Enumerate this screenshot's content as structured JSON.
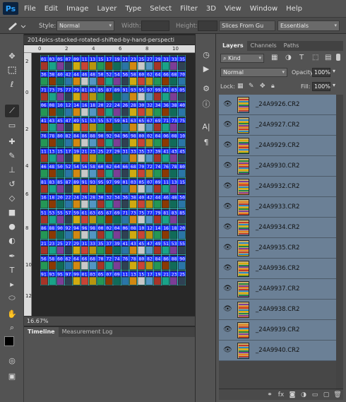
{
  "app": {
    "logo": "Ps"
  },
  "menu": [
    "File",
    "Edit",
    "Image",
    "Layer",
    "Type",
    "Select",
    "Filter",
    "3D",
    "View",
    "Window",
    "Help"
  ],
  "options": {
    "style_label": "Style:",
    "style_value": "Normal",
    "width_label": "Width:",
    "height_label": "Height:",
    "slices_button": "Slices From Gu",
    "workspace": "Essentials"
  },
  "document": {
    "tab_title": "2014pics-stacked-rotated-shifted-by-hand-perspecti",
    "zoom": "16.67%",
    "ruler_top": [
      "0",
      "2",
      "4",
      "6",
      "8",
      "10"
    ],
    "ruler_left": [
      "2",
      "0",
      "2",
      "4",
      "6",
      "8",
      "10",
      "12"
    ],
    "row_label_sequences": [
      "01 03 05 07 09 11 13 15 17 19 21 23 25 27 29 31 33 35",
      "36 38 40 42 44 46 48 50 52 54 56 58 60 62 64 66 68 70",
      "71 73 75 77 79 81 83 85 87 89 91 93 95 97 99 01 03 05",
      "06 08 10 12 14 16 18 20 22 24 26 28 30 32 34 36 38 40",
      "41 43 45 47 49 51 53 55 57 59 61 63 65 67 69 71 73 75",
      "76 78 80 82 84 86 88 90 92 94 96 98 00 02 04 06 08 10",
      "11 13 15 17 19 21 23 25 27 29 31 33 35 37 39 41 43 45",
      "46 48 50 52 54 56 58 60 62 64 66 68 70 72 74 76 78 80",
      "81 83 85 87 89 91 93 95 97 99 01 03 05 07 09 11 13 15",
      "16 18 20 22 24 26 28 30 32 34 36 38 40 42 44 46 48 50",
      "51 53 55 57 59 61 63 65 67 69 71 73 75 77 79 81 83 85",
      "86 88 90 92 94 96 98 00 02 04 06 08 10 12 14 16 18 20",
      "21 23 25 27 29 31 33 35 37 39 41 43 45 47 49 51 53 55",
      "56 58 60 62 64 66 68 70 72 74 76 78 80 82 84 86 88 90",
      "91 93 95 97 99 01 03 05 07 09 11 13 15 17 19 21 23 25"
    ]
  },
  "bottom_panel": {
    "tabs": [
      "Timeline",
      "Measurement Log"
    ]
  },
  "layers_panel": {
    "tabs": [
      "Layers",
      "Channels",
      "Paths"
    ],
    "kind_label": "Kind",
    "blend_mode": "Normal",
    "opacity_label": "Opacity:",
    "opacity_value": "100%",
    "lock_label": "Lock:",
    "fill_label": "Fill:",
    "fill_value": "100%",
    "layers": [
      "_24A9926.CR2",
      "_24A9927.CR2",
      "_24A9929.CR2",
      "_24A9930.CR2",
      "_24A9932.CR2",
      "_24A9933.CR2",
      "_24A9934.CR2",
      "_24A9935.CR2",
      "_24A9936.CR2",
      "_24A9937.CR2",
      "_24A9938.CR2",
      "_24A9939.CR2",
      "_24A9940.CR2"
    ]
  },
  "colors": {
    "selection_row": "#6b8096",
    "guide_cyan": "#3ad6d6",
    "label_blue": "#1e2cff"
  }
}
